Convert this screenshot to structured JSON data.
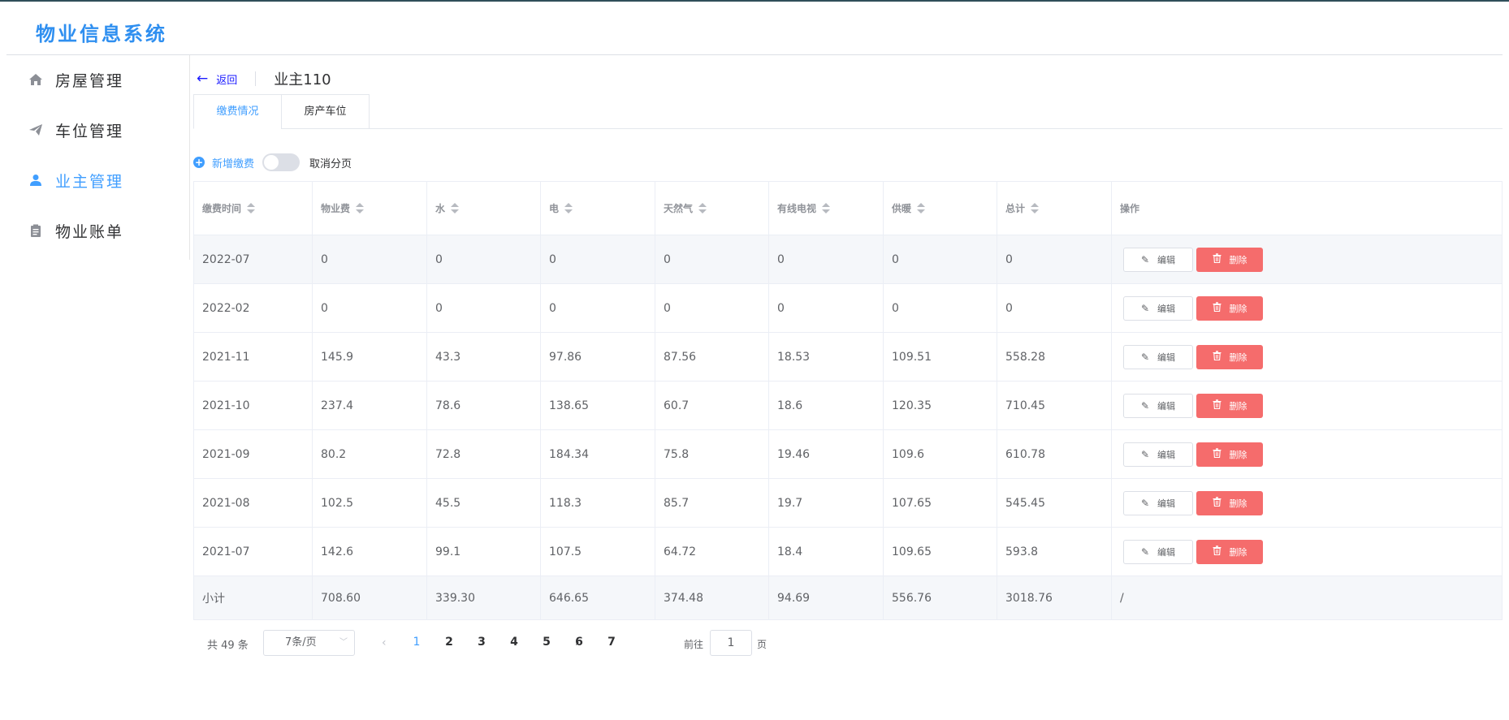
{
  "app": {
    "title": "物业信息系统"
  },
  "sidebar": {
    "items": [
      {
        "label": "房屋管理",
        "icon": "home-icon"
      },
      {
        "label": "车位管理",
        "icon": "paper-plane-icon"
      },
      {
        "label": "业主管理",
        "icon": "user-icon",
        "active": true
      },
      {
        "label": "物业账单",
        "icon": "clipboard-icon"
      }
    ]
  },
  "page_header": {
    "back_label": "返回",
    "title": "业主110"
  },
  "tabs": [
    {
      "label": "缴费情况",
      "active": true
    },
    {
      "label": "房产车位",
      "active": false
    }
  ],
  "toolbar": {
    "add_label": "新增缴费",
    "switch_label": "取消分页",
    "switch_on": false
  },
  "table": {
    "columns": [
      "缴费时间",
      "物业费",
      "水",
      "电",
      "天然气",
      "有线电视",
      "供暖",
      "总计",
      "操作"
    ],
    "rows": [
      [
        "2022-07",
        "0",
        "0",
        "0",
        "0",
        "0",
        "0",
        "0"
      ],
      [
        "2022-02",
        "0",
        "0",
        "0",
        "0",
        "0",
        "0",
        "0"
      ],
      [
        "2021-11",
        "145.9",
        "43.3",
        "97.86",
        "87.56",
        "18.53",
        "109.51",
        "558.28"
      ],
      [
        "2021-10",
        "237.4",
        "78.6",
        "138.65",
        "60.7",
        "18.6",
        "120.35",
        "710.45"
      ],
      [
        "2021-09",
        "80.2",
        "72.8",
        "184.34",
        "75.8",
        "19.46",
        "109.6",
        "610.78"
      ],
      [
        "2021-08",
        "102.5",
        "45.5",
        "118.3",
        "85.7",
        "19.7",
        "107.65",
        "545.45"
      ],
      [
        "2021-07",
        "142.6",
        "99.1",
        "107.5",
        "64.72",
        "18.4",
        "109.65",
        "593.8"
      ]
    ],
    "edit_label": "编辑",
    "delete_label": "删除",
    "summary": [
      "小计",
      "708.60",
      "339.30",
      "646.65",
      "374.48",
      "94.69",
      "556.76",
      "3018.76",
      "/"
    ]
  },
  "pagination": {
    "total_label": "共 49 条",
    "page_size": "7条/页",
    "pages": [
      "1",
      "2",
      "3",
      "4",
      "5",
      "6",
      "7"
    ],
    "current_page": "1",
    "goto_label": "前往",
    "goto_value": "1",
    "page_suffix": "页"
  },
  "colors": {
    "accent": "#409eff",
    "danger": "#f56c6c",
    "title": "#2f8ff0"
  }
}
